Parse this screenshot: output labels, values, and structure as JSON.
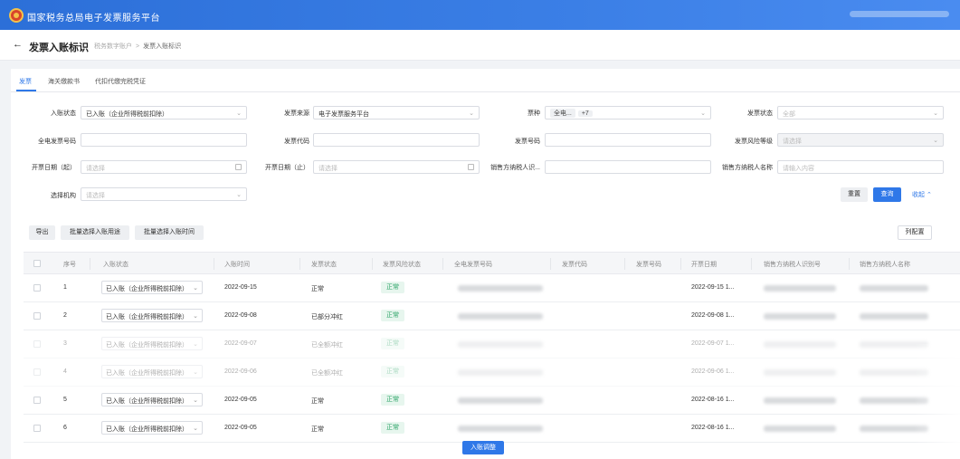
{
  "header": {
    "title": "国家税务总局电子发票服务平台"
  },
  "subheader": {
    "back_icon": "←",
    "page_title": "发票入账标识",
    "breadcrumb": [
      "税务数字账户",
      "发票入账标识"
    ],
    "breadcrumb_sep": ">"
  },
  "tabs": [
    "发票",
    "海关缴款书",
    "代扣代缴完税凭证"
  ],
  "filters": {
    "entry_status": {
      "label": "入账状态",
      "value": "已入账（企业所得税前扣除）"
    },
    "invoice_source": {
      "label": "发票来源",
      "value": "电子发票服务平台"
    },
    "invoice_type": {
      "label": "票种",
      "chip1": "全电...",
      "chip2": "+7"
    },
    "invoice_status": {
      "label": "发票状态",
      "placeholder": "全部"
    },
    "full_number": {
      "label": "全电发票号码"
    },
    "invoice_code": {
      "label": "发票代码"
    },
    "invoice_number": {
      "label": "发票号码"
    },
    "risk_level": {
      "label": "发票风险等级",
      "placeholder": "请选择"
    },
    "date_start": {
      "label": "开票日期（起）",
      "placeholder": "请选择"
    },
    "date_end": {
      "label": "开票日期（止）",
      "placeholder": "请选择"
    },
    "seller_tax_id": {
      "label": "销售方纳税人识..."
    },
    "seller_name": {
      "label": "销售方纳税人名称",
      "placeholder": "请输入内容"
    },
    "org": {
      "label": "选择机构",
      "placeholder": "请选择"
    }
  },
  "actions": {
    "reset": "重置",
    "query": "查询",
    "collapse": "收起",
    "export": "导出",
    "batch_usage": "批量选择入账用途",
    "batch_time": "批量选择入账时间",
    "column_config": "列配置"
  },
  "table": {
    "headers": [
      "序号",
      "入账状态",
      "入账时间",
      "发票状态",
      "发票风险状态",
      "全电发票号码",
      "发票代码",
      "发票号码",
      "开票日期",
      "销售方纳税人识别号",
      "销售方纳税人名称"
    ],
    "rows": [
      {
        "no": "1",
        "entry": "已入账（企业所得税前扣除）",
        "time": "2022-09-15",
        "status": "正常",
        "risk": "正常",
        "date": "2022-09-15 1..."
      },
      {
        "no": "2",
        "entry": "已入账（企业所得税前扣除）",
        "time": "2022-09-08",
        "status": "已部分冲红",
        "risk": "正常",
        "date": "2022-09-08 1..."
      },
      {
        "no": "3",
        "entry": "已入账（企业所得税前扣除）",
        "time": "2022-09-07",
        "status": "已全额冲红",
        "risk": "正常",
        "date": "2022-09-07 1..."
      },
      {
        "no": "4",
        "entry": "已入账（企业所得税前扣除）",
        "time": "2022-09-06",
        "status": "已全额冲红",
        "risk": "正常",
        "date": "2022-09-06 1..."
      },
      {
        "no": "5",
        "entry": "已入账（企业所得税前扣除）",
        "time": "2022-09-05",
        "status": "正常",
        "risk": "正常",
        "date": "2022-08-16 1..."
      },
      {
        "no": "6",
        "entry": "已入账（企业所得税前扣除）",
        "time": "2022-09-05",
        "status": "正常",
        "risk": "正常",
        "date": "2022-08-16 1..."
      }
    ]
  },
  "footer": {
    "adjust_button": "入账调整"
  },
  "colors": {
    "brand": "#2f78e8",
    "risk_ok": "#2ba366"
  }
}
